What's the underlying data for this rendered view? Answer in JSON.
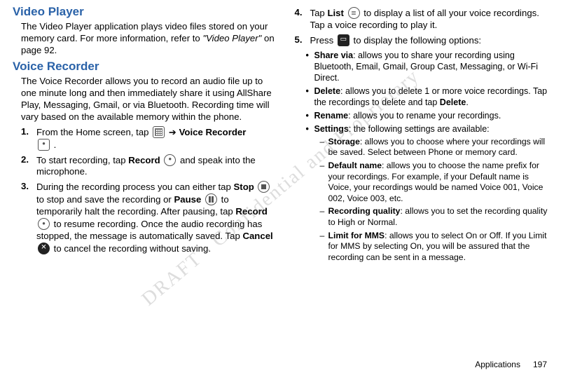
{
  "left": {
    "h1": "Video Player",
    "p1a": "The Video Player application plays video files stored on your memory card. For more information, refer to ",
    "p1b": "\"Video Player\"",
    "p1c": " on page 92.",
    "h2": "Voice Recorder",
    "p2": "The Voice Recorder allows you to record an audio file up to one minute long and then immediately share it using AllShare Play, Messaging, Gmail, or via Bluetooth. Recording time will vary based on the available memory within the phone.",
    "n1": "1.",
    "n1a": "From the Home screen, tap ",
    "n1b": " ➔ ",
    "n1c": "Voice Recorder",
    "n1d": " .",
    "n2": "2.",
    "n2a": "To start recording, tap ",
    "n2b": "Record",
    "n2c": " and speak into the microphone.",
    "n3": "3.",
    "n3a": "During the recording process you can either tap ",
    "n3b": "Stop",
    "n3c": " to stop and save the recording or ",
    "n3d": "Pause",
    "n3e": " to temporarily halt the recording. After pausing, tap ",
    "n3f": "Record",
    "n3g": " to resume recording. Once the audio recording has stopped, the message is automatically saved. Tap ",
    "n3h": "Cancel",
    "n3i": " to cancel the recording without saving."
  },
  "right": {
    "n4": "4.",
    "n4a": "Tap ",
    "n4b": "List",
    "n4c": " to display a list of all your voice recordings. Tap a voice recording to play it.",
    "n5": "5.",
    "n5a": "Press ",
    "n5b": " to display the following options:",
    "b1t": "Share via",
    "b1": ": allows you to share your recording using Bluetooth, Email, Gmail, Group Cast, Messaging, or Wi-Fi Direct.",
    "b2t": "Delete",
    "b2a": ": allows you to delete 1 or more voice recordings. Tap the recordings to delete and tap ",
    "b2b": "Delete",
    "b2c": ".",
    "b3t": "Rename",
    "b3": ": allows you to rename your recordings.",
    "b4t": "Settings",
    "b4": ": the following settings are available:",
    "d1t": "Storage",
    "d1": ": allows you to choose where your recordings will be saved. Select between Phone or memory card.",
    "d2t": "Default name",
    "d2": ": allows you to choose the name prefix for your recordings. For example, if your Default name is Voice, your recordings would be named Voice 001, Voice 002, Voice 003, etc.",
    "d3t": "Recording quality",
    "d3": ": allows you to set the recording quality to High or Normal.",
    "d4t": "Limit for MMS",
    "d4": ": allows you to select On or Off. If you Limit for MMS by selecting On, you will be assured that the recording can be sent in a message."
  },
  "footer": {
    "section": "Applications",
    "page": "197"
  },
  "watermark": "DRAFT - Confidential and Proprietary"
}
